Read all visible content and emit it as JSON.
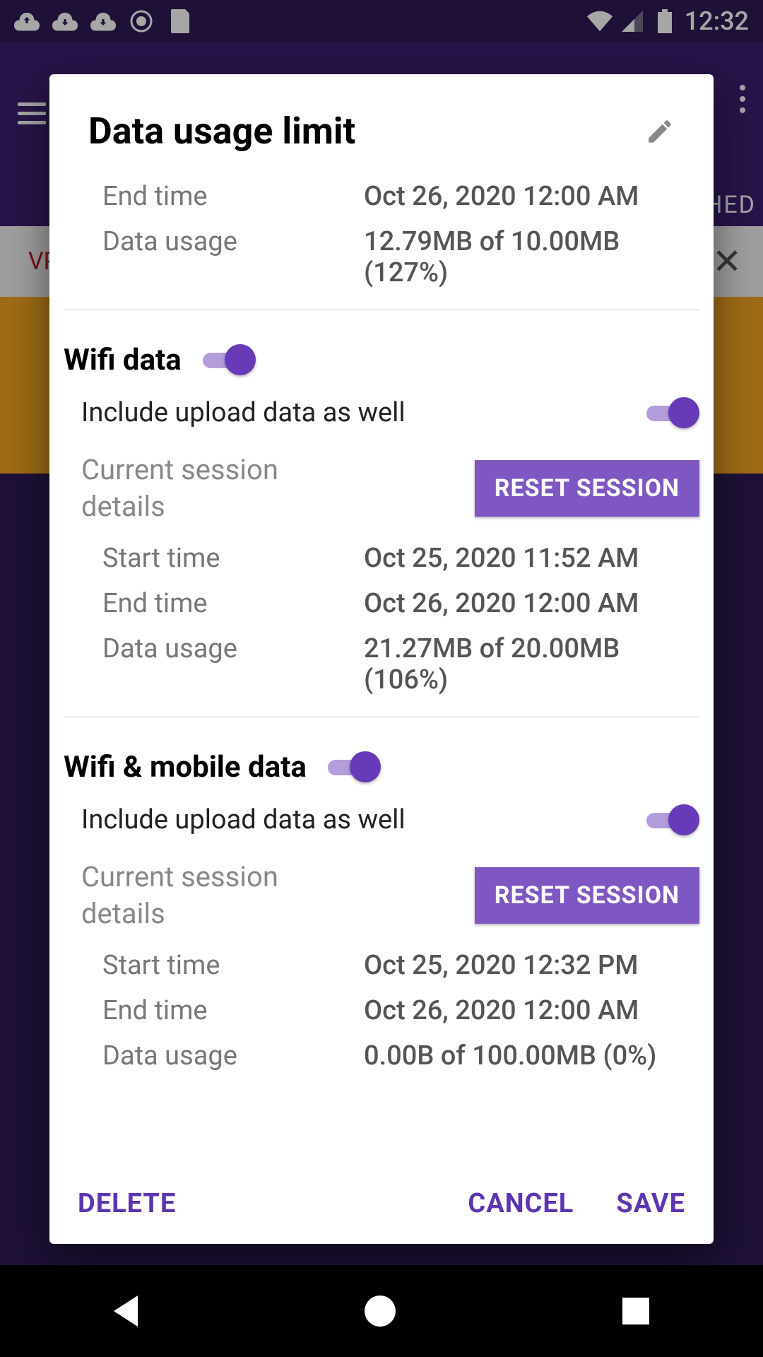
{
  "status": {
    "time": "12:32"
  },
  "background": {
    "tab_text": "HED",
    "vpn_text": "VP"
  },
  "dialog": {
    "title": "Data usage limit",
    "top": {
      "end_time": {
        "label": "End time",
        "value": "Oct 26, 2020 12:00 AM"
      },
      "data_usage": {
        "label": "Data usage",
        "value": "12.79MB of 10.00MB (127%)"
      }
    },
    "wifi": {
      "heading": "Wifi data",
      "include_upload": "Include upload data as well",
      "session_label": "Current session details",
      "reset": "RESET SESSION",
      "start_time": {
        "label": "Start time",
        "value": "Oct 25, 2020 11:52 AM"
      },
      "end_time": {
        "label": "End time",
        "value": "Oct 26, 2020 12:00 AM"
      },
      "data_usage": {
        "label": "Data usage",
        "value": "21.27MB of 20.00MB (106%)"
      }
    },
    "combo": {
      "heading": "Wifi & mobile data",
      "include_upload": "Include upload data as well",
      "session_label": "Current session details",
      "reset": "RESET SESSION",
      "start_time": {
        "label": "Start time",
        "value": "Oct 25, 2020 12:32 PM"
      },
      "end_time": {
        "label": "End time",
        "value": "Oct 26, 2020 12:00 AM"
      },
      "data_usage": {
        "label": "Data usage",
        "value": "0.00B of 100.00MB (0%)"
      }
    },
    "footer": {
      "delete": "DELETE",
      "cancel": "CANCEL",
      "save": "SAVE"
    }
  }
}
